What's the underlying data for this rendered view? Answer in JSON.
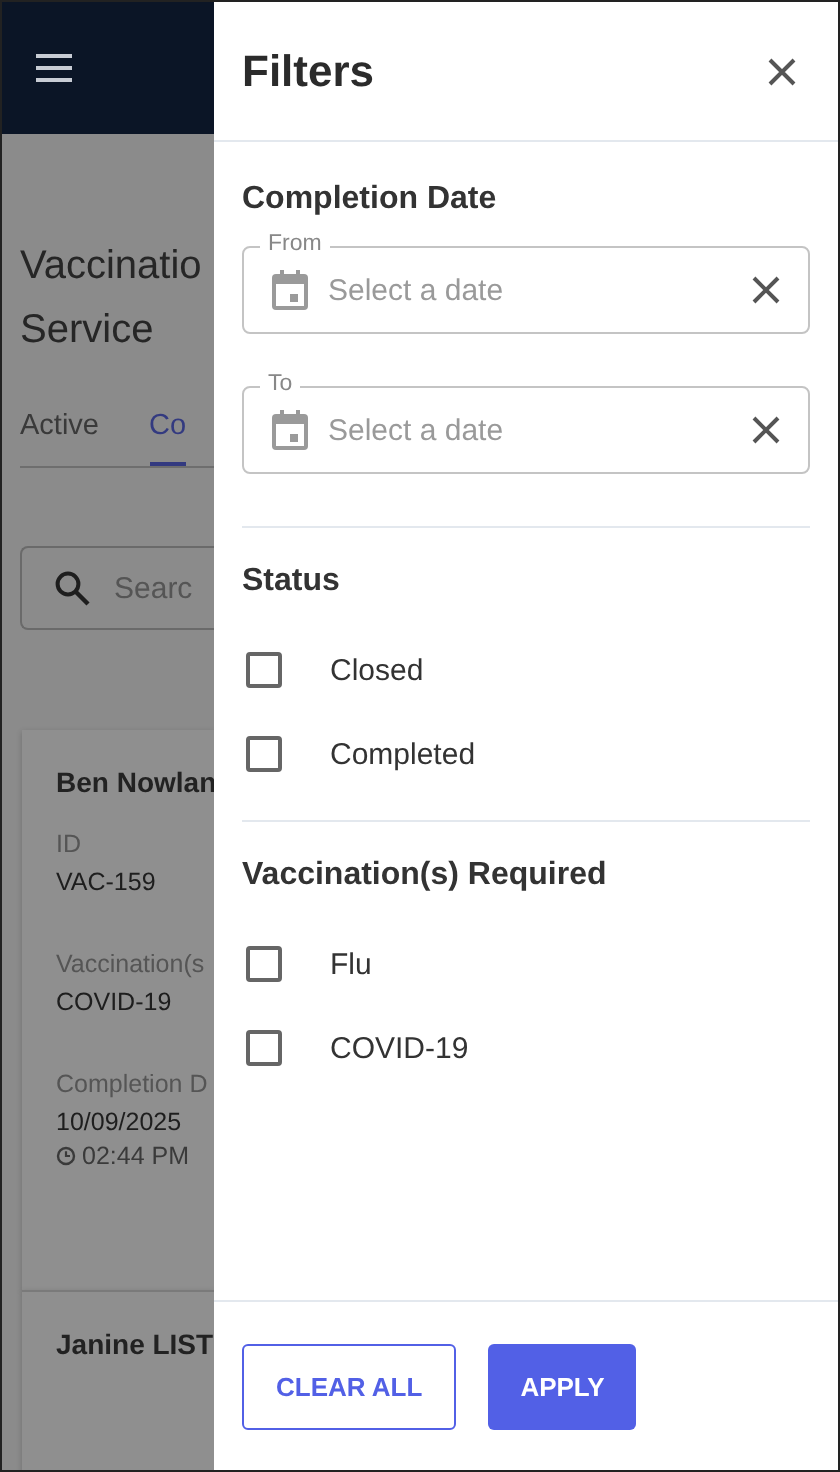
{
  "page": {
    "title_lines": [
      "Vaccinatio",
      "Service"
    ],
    "tabs": [
      {
        "label": "Active",
        "selected": false
      },
      {
        "label": "Co",
        "selected": true
      }
    ],
    "search": {
      "placeholder": "Searc"
    },
    "cards": [
      {
        "name": "Ben Nowlan",
        "fields": [
          {
            "label": "ID",
            "value": "VAC-159"
          },
          {
            "label": "Vaccination(s",
            "value": "COVID-19"
          },
          {
            "label": "Completion D",
            "value": "10/09/2025",
            "time": "02:44 PM"
          }
        ]
      },
      {
        "name": "Janine LIST"
      }
    ]
  },
  "drawer": {
    "title": "Filters",
    "date_section": {
      "heading": "Completion Date",
      "fields": [
        {
          "label": "From",
          "placeholder": "Select a date"
        },
        {
          "label": "To",
          "placeholder": "Select a date"
        }
      ]
    },
    "sections": [
      {
        "heading": "Status",
        "options": [
          {
            "label": "Closed",
            "checked": false
          },
          {
            "label": "Completed",
            "checked": false
          }
        ]
      },
      {
        "heading": "Vaccination(s) Required",
        "options": [
          {
            "label": "Flu",
            "checked": false
          },
          {
            "label": "COVID-19",
            "checked": false
          }
        ]
      }
    ],
    "buttons": [
      {
        "label": "CLEAR ALL",
        "kind": "outlined"
      },
      {
        "label": "APPLY",
        "kind": "filled"
      }
    ]
  }
}
